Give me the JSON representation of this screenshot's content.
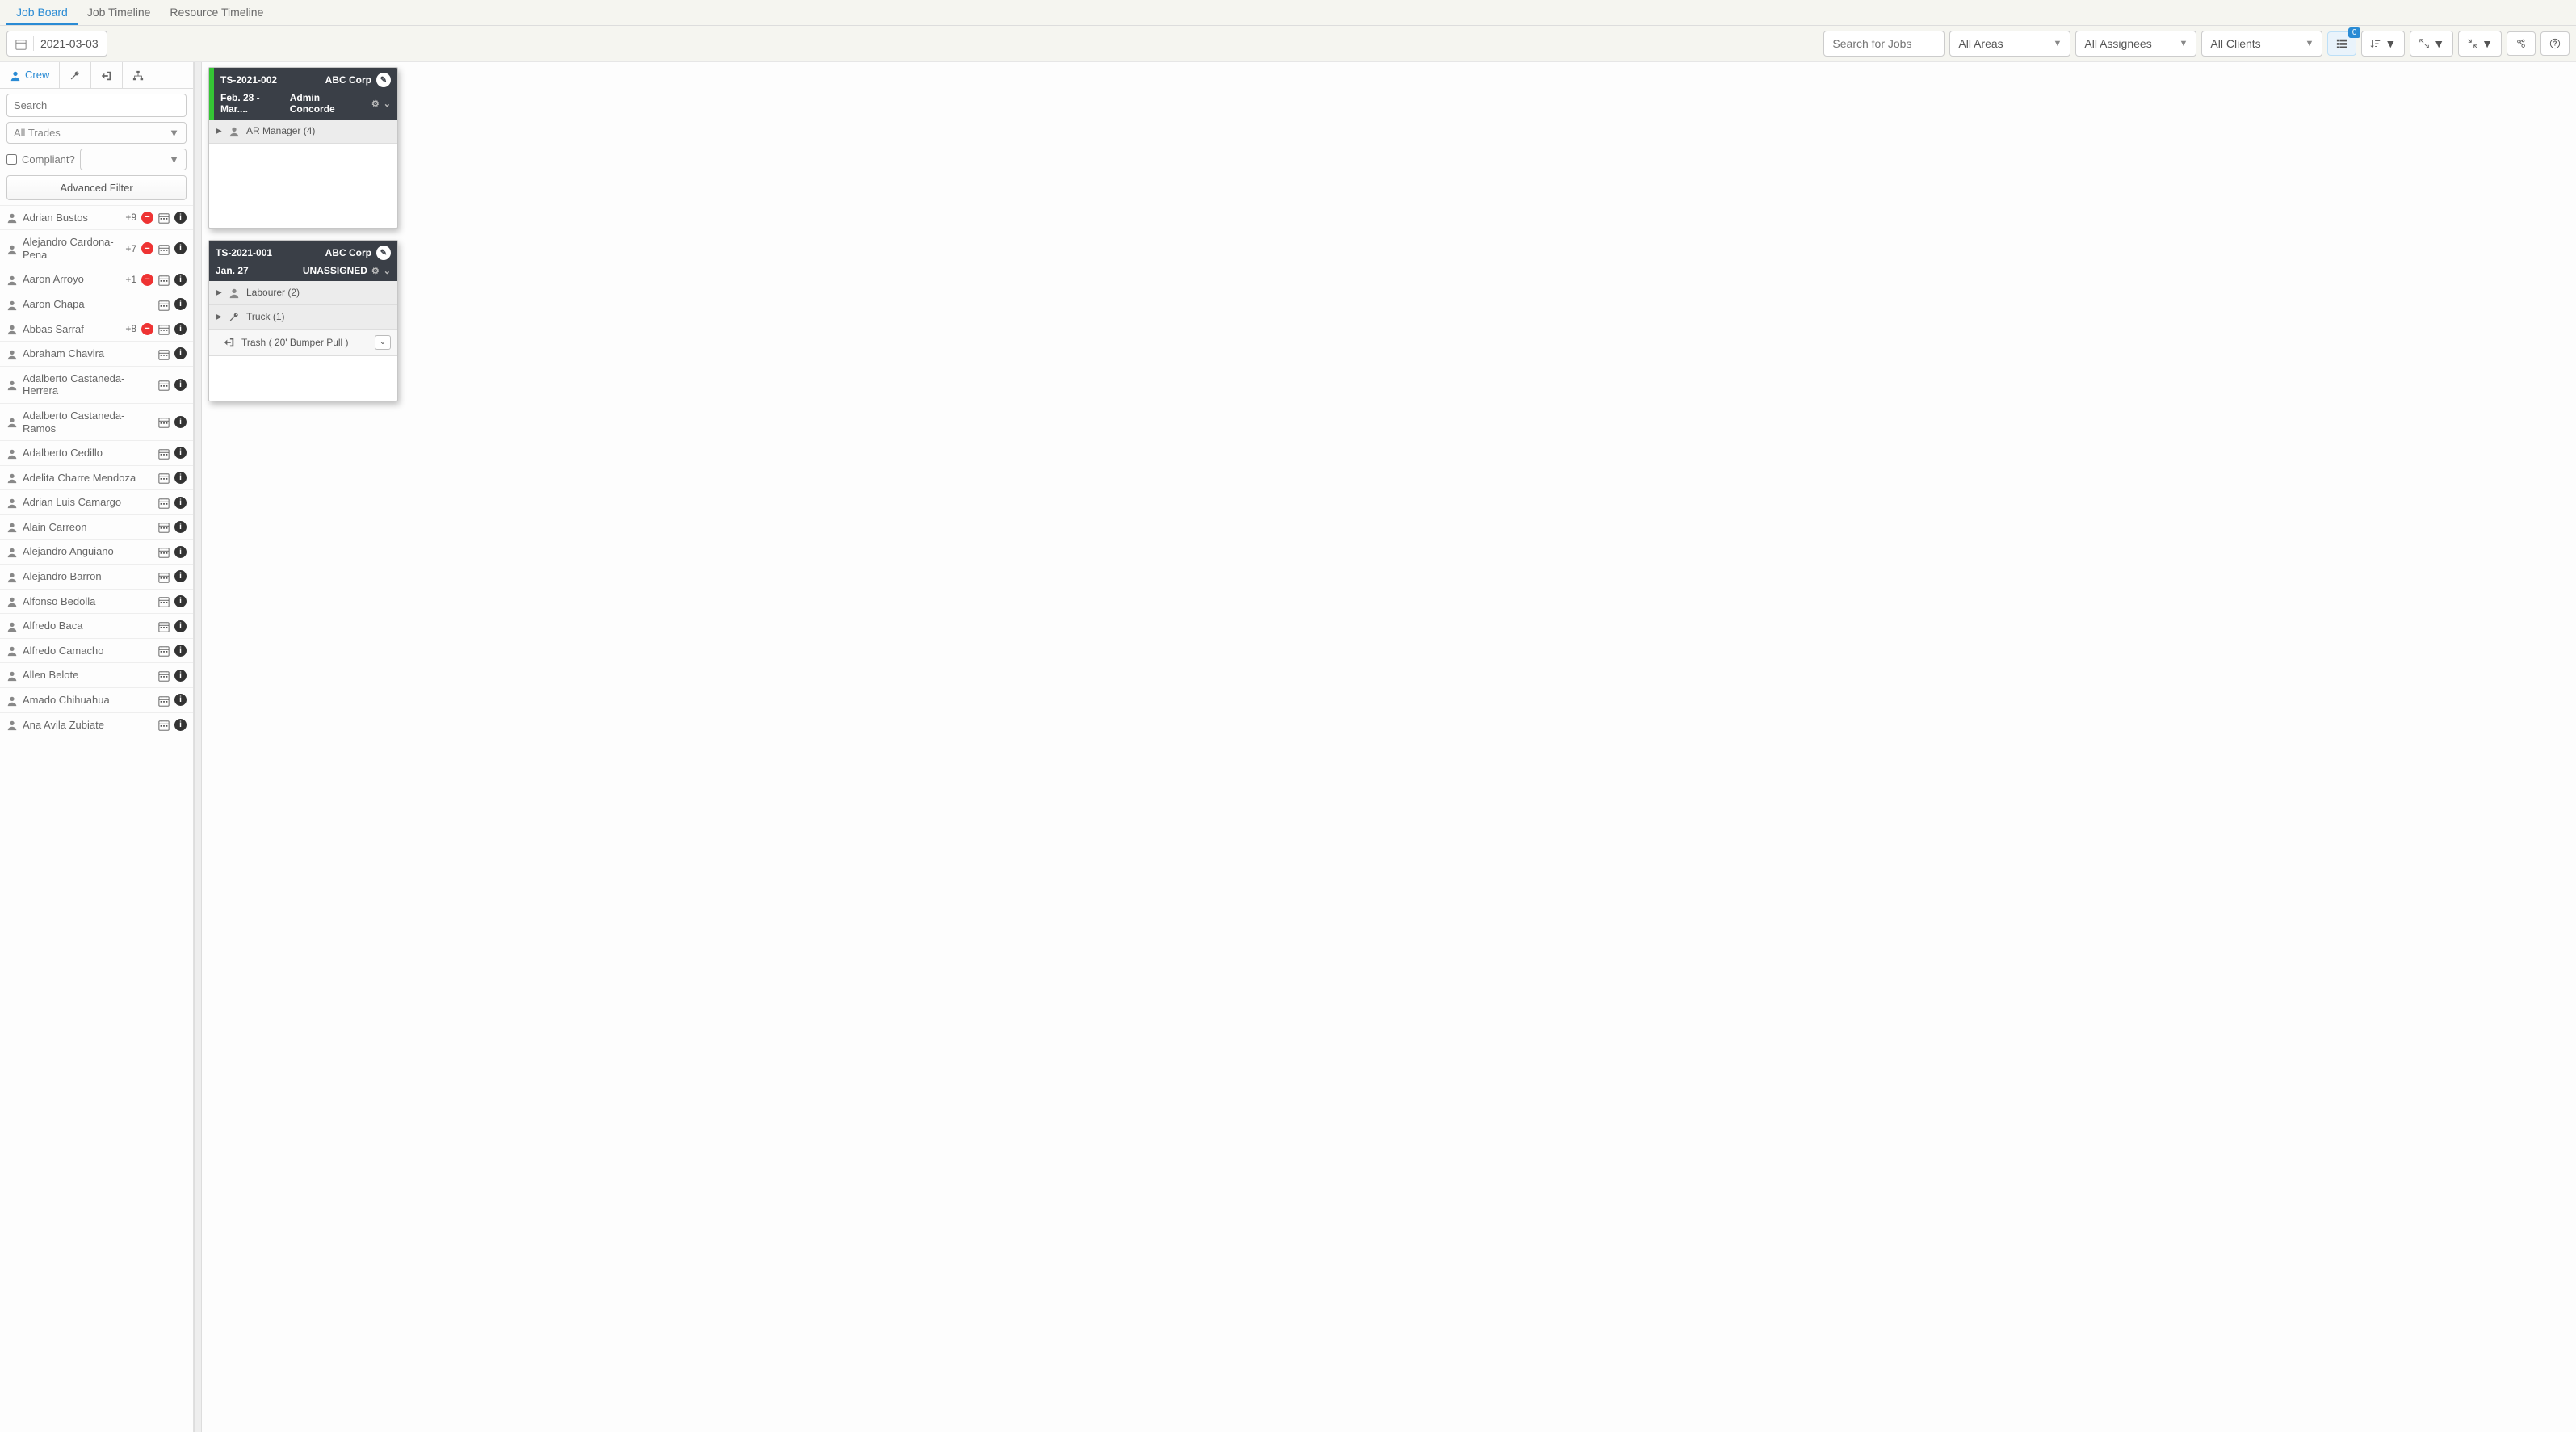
{
  "nav": {
    "tabs": [
      {
        "label": "Job Board",
        "active": true
      },
      {
        "label": "Job Timeline",
        "active": false
      },
      {
        "label": "Resource Timeline",
        "active": false
      }
    ]
  },
  "toolbar": {
    "date": "2021-03-03",
    "search_placeholder": "Search for Jobs",
    "areas": "All Areas",
    "assignees": "All Assignees",
    "clients": "All Clients",
    "badge": "0"
  },
  "sidebar": {
    "active_tab_label": "Crew",
    "search_placeholder": "Search",
    "trades_placeholder": "All Trades",
    "compliant_label": "Compliant?",
    "adv_filter_label": "Advanced Filter",
    "crew": [
      {
        "name": "Adrian Bustos",
        "extra": "+9",
        "busy": true
      },
      {
        "name": "Alejandro Cardona-Pena",
        "extra": "+7",
        "busy": true
      },
      {
        "name": "Aaron Arroyo",
        "extra": "+1",
        "busy": true
      },
      {
        "name": "Aaron Chapa",
        "extra": "",
        "busy": false
      },
      {
        "name": "Abbas Sarraf",
        "extra": "+8",
        "busy": true
      },
      {
        "name": "Abraham Chavira",
        "extra": "",
        "busy": false
      },
      {
        "name": "Adalberto Castaneda-Herrera",
        "extra": "",
        "busy": false
      },
      {
        "name": "Adalberto Castaneda-Ramos",
        "extra": "",
        "busy": false
      },
      {
        "name": "Adalberto Cedillo",
        "extra": "",
        "busy": false
      },
      {
        "name": "Adelita Charre Mendoza",
        "extra": "",
        "busy": false
      },
      {
        "name": "Adrian Luis Camargo",
        "extra": "",
        "busy": false
      },
      {
        "name": "Alain Carreon",
        "extra": "",
        "busy": false
      },
      {
        "name": "Alejandro Anguiano",
        "extra": "",
        "busy": false
      },
      {
        "name": "Alejandro Barron",
        "extra": "",
        "busy": false
      },
      {
        "name": "Alfonso Bedolla",
        "extra": "",
        "busy": false
      },
      {
        "name": "Alfredo Baca",
        "extra": "",
        "busy": false
      },
      {
        "name": "Alfredo Camacho",
        "extra": "",
        "busy": false
      },
      {
        "name": "Allen Belote",
        "extra": "",
        "busy": false
      },
      {
        "name": "Amado Chihuahua",
        "extra": "",
        "busy": false
      },
      {
        "name": "Ana Avila Zubiate",
        "extra": "",
        "busy": false
      }
    ]
  },
  "cards": [
    {
      "id": "TS-2021-002",
      "client": "ABC Corp",
      "dates": "Feb. 28 - Mar....",
      "assignee": "Admin Concorde",
      "accent": true,
      "slots": [
        {
          "type": "person",
          "label": "AR Manager (4)",
          "expandable": true
        }
      ]
    },
    {
      "id": "TS-2021-001",
      "client": "ABC Corp",
      "dates": "Jan. 27",
      "assignee": "UNASSIGNED",
      "accent": false,
      "slots": [
        {
          "type": "person",
          "label": "Labourer (2)",
          "expandable": true
        },
        {
          "type": "wrench",
          "label": "Truck (1)",
          "expandable": true
        },
        {
          "type": "arrow",
          "label": "Trash ( 20' Bumper Pull )",
          "expandable": false,
          "dropdown": true
        }
      ]
    }
  ]
}
